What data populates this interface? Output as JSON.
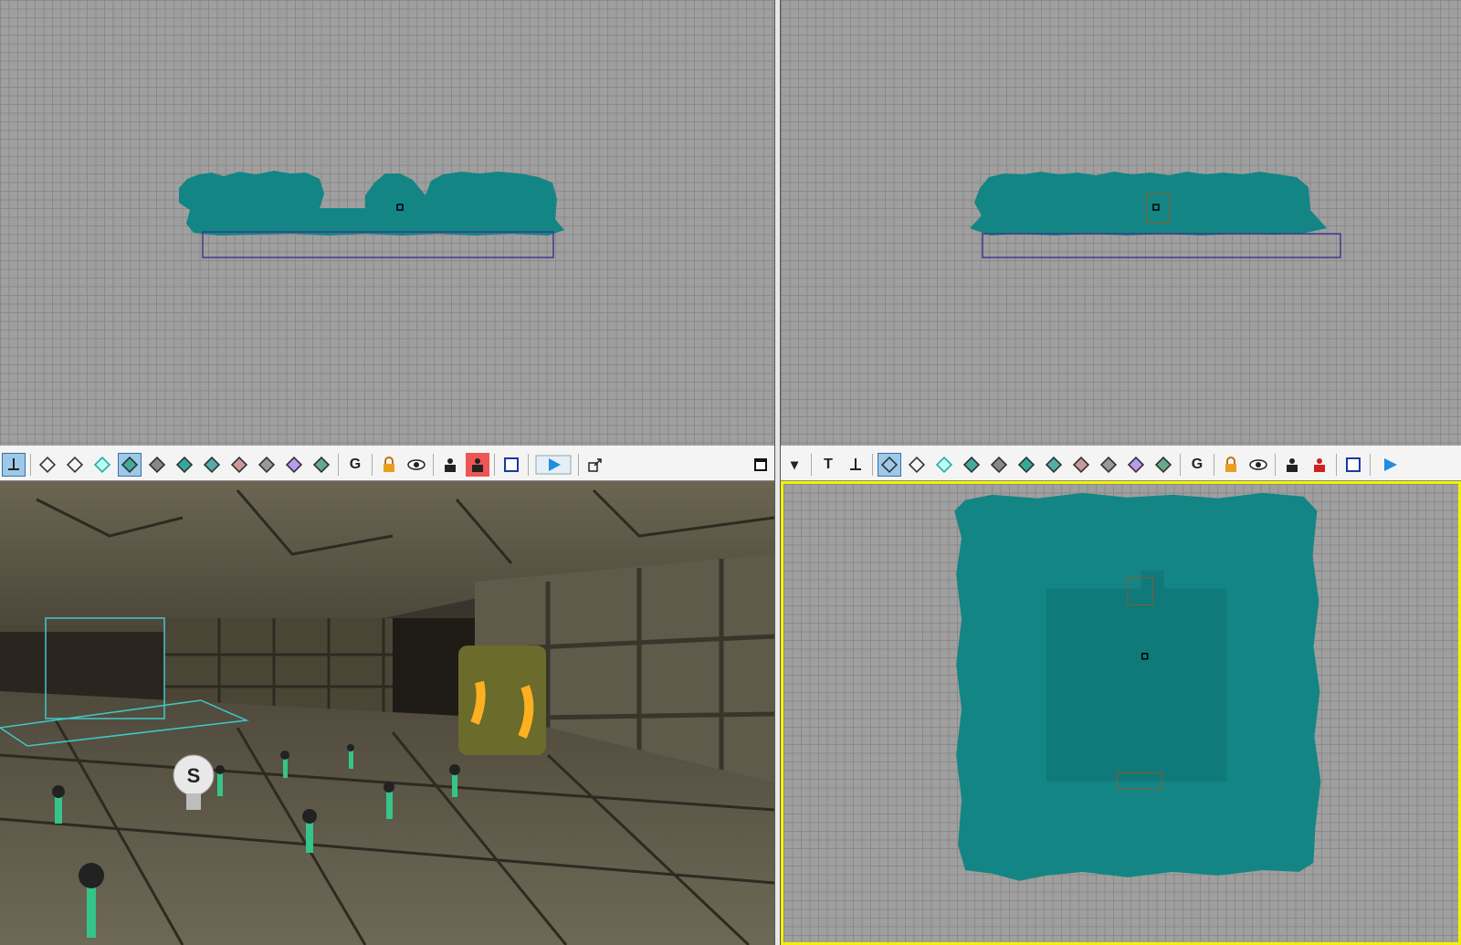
{
  "viewports": {
    "top_left": {
      "type": "orthographic-side"
    },
    "top_right": {
      "type": "orthographic-front"
    },
    "bottom_left": {
      "type": "perspective",
      "light_actor_label": "S"
    },
    "bottom_right": {
      "type": "orthographic-top",
      "active": true
    }
  },
  "toolbar_left": {
    "buttons": [
      "viewport-options",
      "wireframe",
      "brush-wireframe",
      "zone",
      "textured",
      "dynamic-light",
      "lighting-only",
      "depth-complexity",
      "texture-usage",
      "lightmap",
      "mesh-occluders",
      "stripped-mesh",
      "G",
      "lock",
      "visibility",
      "actor-view",
      "hidden-actors",
      "maximize",
      "realtime-preview",
      "window",
      "maximize-viewport"
    ]
  },
  "toolbar_right": {
    "dropdown_label": "▾",
    "text_label": "T",
    "grid_label": "G"
  },
  "colors": {
    "foliage": "#138584",
    "grid_bg": "#9f9f9f",
    "grid_line": "#8a8a8a",
    "selected_border": "#f2f200",
    "brush_outline": "#3b3b8f"
  }
}
